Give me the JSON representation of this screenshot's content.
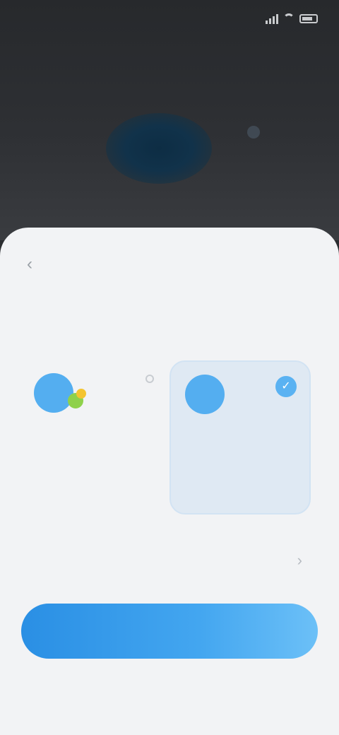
{
  "status_bar": {
    "time": "",
    "battery": ""
  },
  "sheet": {
    "title": "",
    "headline": "",
    "back_icon": "back-arrow-icon"
  },
  "options": [
    {
      "title": "",
      "description": "",
      "icon": "people-icon",
      "selected": false
    },
    {
      "title": "",
      "description": "",
      "icon": "person-icon",
      "selected": true
    }
  ],
  "settings_row": {
    "label": "",
    "sublabel": "",
    "chevron_icon": "chevron-right-icon"
  },
  "primary_button": {
    "label": ""
  },
  "footer": {
    "text": ""
  },
  "colors": {
    "accent": "#43a6f0",
    "sheet_background": "#f2f3f5",
    "selected_card_background": "#dfe9f3",
    "top_background": "#2b2d30"
  }
}
